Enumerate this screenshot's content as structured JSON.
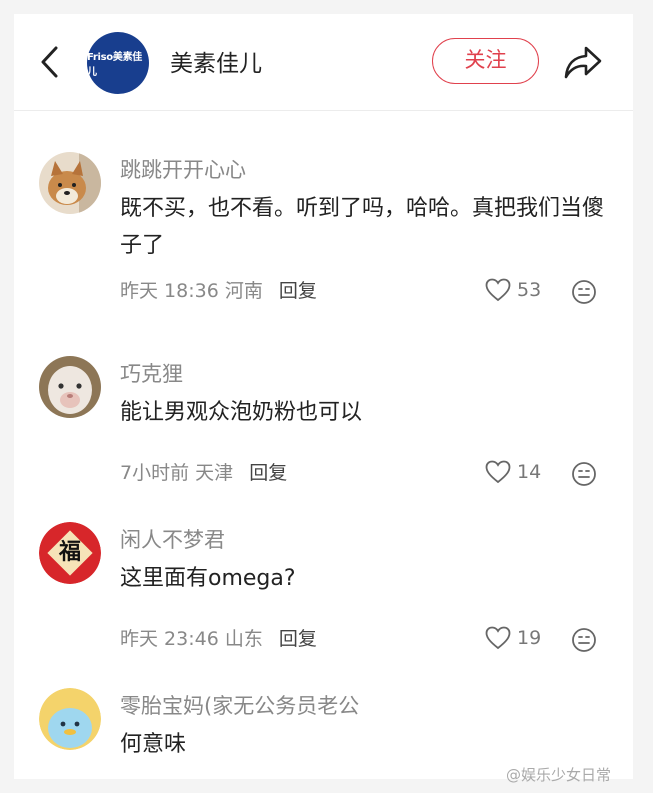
{
  "header": {
    "brand_logo_text": "Friso美素佳儿",
    "account_name": "美素佳儿",
    "follow_label": "关注"
  },
  "comments": [
    {
      "username": "跳跳开开心心",
      "text": "既不买，也不看。听到了吗，哈哈。真把我们当傻子了",
      "time": "昨天 18:36",
      "location": "河南",
      "reply_label": "回复",
      "likes": "53"
    },
    {
      "username": "巧克狸",
      "text": "能让男观众泡奶粉也可以",
      "time": "7小时前",
      "location": "天津",
      "reply_label": "回复",
      "likes": "14"
    },
    {
      "username": "闲人不梦君",
      "text": "这里面有omega?",
      "time": "昨天 23:46",
      "location": "山东",
      "reply_label": "回复",
      "likes": "19",
      "avatar_text": "福"
    },
    {
      "username": "零胎宝妈(家无公务员老公",
      "text": "何意味"
    }
  ],
  "watermark": "@娱乐少女日常",
  "colors": {
    "accent": "#e0414d",
    "brand_blue": "#183e8e"
  }
}
